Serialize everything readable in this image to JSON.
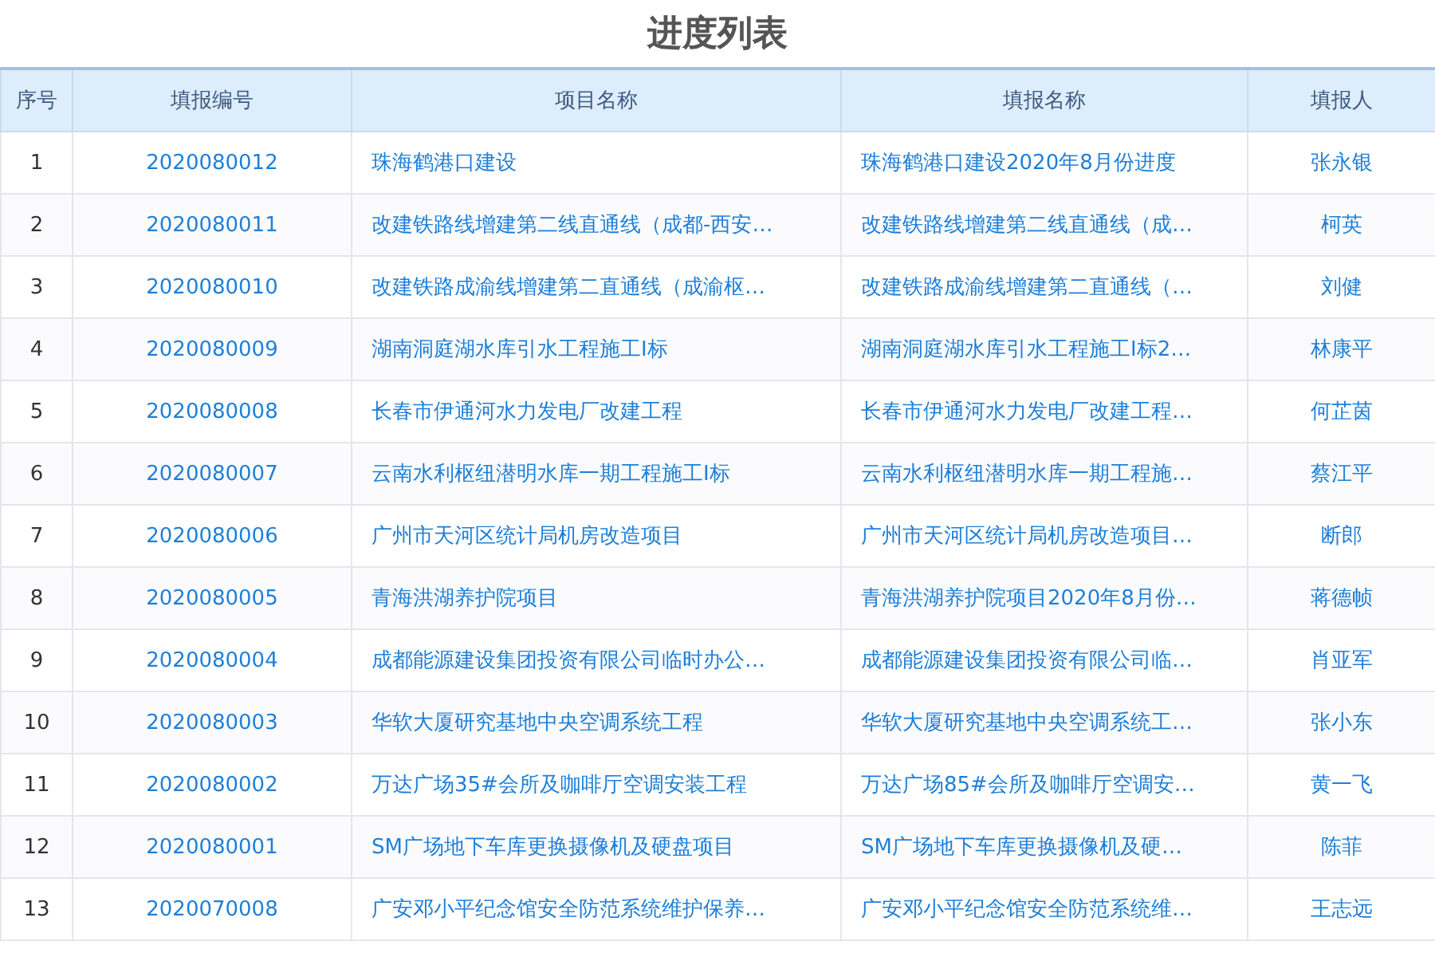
{
  "title": "进度列表",
  "table": {
    "columns": [
      "序号",
      "填报编号",
      "项目名称",
      "填报名称",
      "填报人"
    ],
    "rows": [
      {
        "index": "1",
        "code": "2020080012",
        "project": "珠海鹤港口建设",
        "report": "珠海鹤港口建设2020年8月份进度",
        "reporter": "张永银"
      },
      {
        "index": "2",
        "code": "2020080011",
        "project": "改建铁路线增建第二线直通线（成都-西安…",
        "report": "改建铁路线增建第二线直通线（成…",
        "reporter": "柯英"
      },
      {
        "index": "3",
        "code": "2020080010",
        "project": "改建铁路成渝线增建第二直通线（成渝枢…",
        "report": "改建铁路成渝线增建第二直通线（…",
        "reporter": "刘健"
      },
      {
        "index": "4",
        "code": "2020080009",
        "project": "湖南洞庭湖水库引水工程施工I标",
        "report": "湖南洞庭湖水库引水工程施工I标2…",
        "reporter": "林康平"
      },
      {
        "index": "5",
        "code": "2020080008",
        "project": "长春市伊通河水力发电厂改建工程",
        "report": "长春市伊通河水力发电厂改建工程…",
        "reporter": "何芷茵"
      },
      {
        "index": "6",
        "code": "2020080007",
        "project": "云南水利枢纽潜明水库一期工程施工I标",
        "report": "云南水利枢纽潜明水库一期工程施…",
        "reporter": "蔡江平"
      },
      {
        "index": "7",
        "code": "2020080006",
        "project": "广州市天河区统计局机房改造项目",
        "report": "广州市天河区统计局机房改造项目…",
        "reporter": "断郎"
      },
      {
        "index": "8",
        "code": "2020080005",
        "project": "青海洪湖养护院项目",
        "report": "青海洪湖养护院项目2020年8月份…",
        "reporter": "蒋德帧"
      },
      {
        "index": "9",
        "code": "2020080004",
        "project": "成都能源建设集团投资有限公司临时办公…",
        "report": "成都能源建设集团投资有限公司临…",
        "reporter": "肖亚军"
      },
      {
        "index": "10",
        "code": "2020080003",
        "project": "华软大厦研究基地中央空调系统工程",
        "report": "华软大厦研究基地中央空调系统工…",
        "reporter": "张小东"
      },
      {
        "index": "11",
        "code": "2020080002",
        "project": "万达广场35#会所及咖啡厅空调安装工程",
        "report": "万达广场85#会所及咖啡厅空调安…",
        "reporter": "黄一飞"
      },
      {
        "index": "12",
        "code": "2020080001",
        "project": "SM广场地下车库更换摄像机及硬盘项目",
        "report": "SM广场地下车库更换摄像机及硬…",
        "reporter": "陈菲"
      },
      {
        "index": "13",
        "code": "2020070008",
        "project": "广安邓小平纪念馆安全防范系统维护保养…",
        "report": "广安邓小平纪念馆安全防范系统维…",
        "reporter": "王志远"
      }
    ]
  }
}
